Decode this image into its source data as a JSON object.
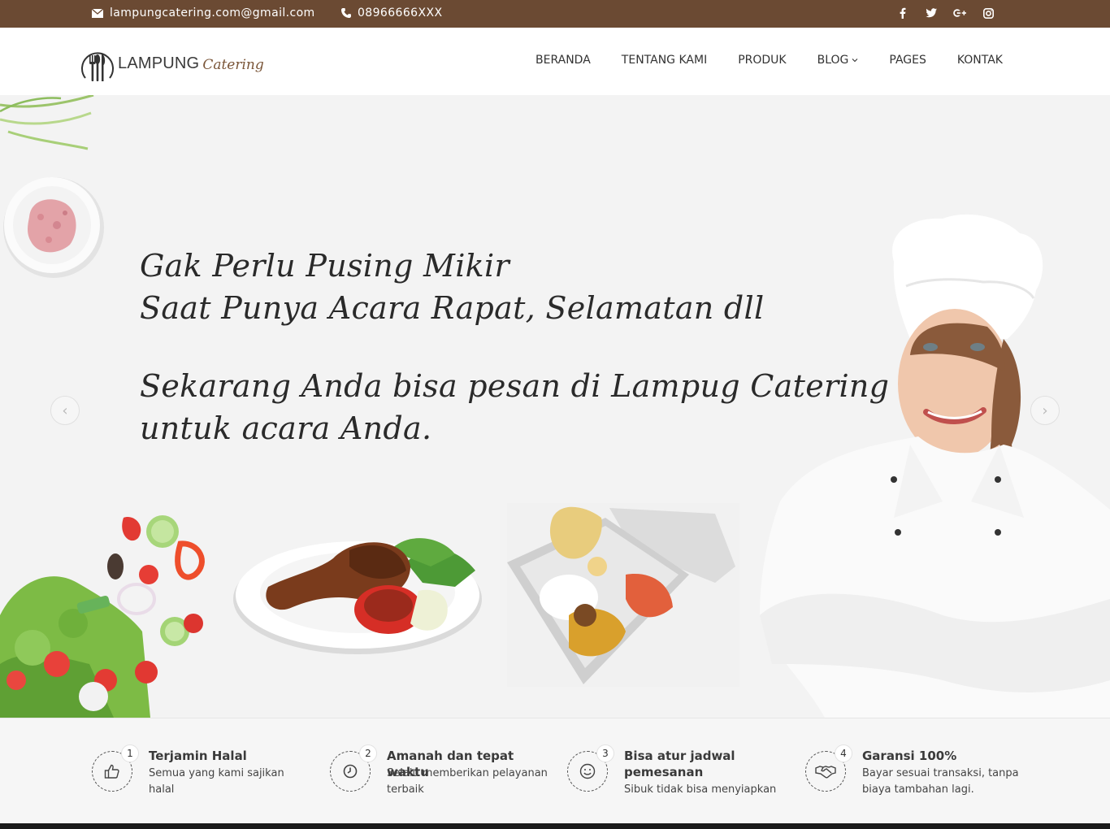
{
  "topbar": {
    "email": "lampungcatering.com@gmail.com",
    "phone": "08966666XXX",
    "social_icons": [
      "facebook-icon",
      "twitter-icon",
      "google-plus-icon",
      "instagram-icon"
    ],
    "bg_color": "#6b4a33"
  },
  "logo": {
    "main": "LAMPUNG",
    "script": "Catering"
  },
  "nav": {
    "items": [
      {
        "label": "BERANDA"
      },
      {
        "label": "TENTANG KAMI"
      },
      {
        "label": "PRODUK"
      },
      {
        "label": "BLOG"
      },
      {
        "label": "PAGES"
      },
      {
        "label": "KONTAK"
      }
    ]
  },
  "hero": {
    "line1": "Gak Perlu Pusing Mikir",
    "line2": "Saat Punya Acara Rapat, Selamatan dll",
    "line3": "Sekarang Anda bisa pesan di Lampug Catering",
    "line4": "untuk acara Anda.",
    "prev_arrow": "‹",
    "next_arrow": "›"
  },
  "features": [
    {
      "num": "1",
      "title": "Terjamin Halal",
      "desc": "Semua yang kami sajikan halal",
      "icon": "thumbs-up-icon"
    },
    {
      "num": "2",
      "title": "Amanah dan tepat waktu",
      "desc": "Selalu memberikan pelayanan terbaik",
      "icon": "clock-icon"
    },
    {
      "num": "3",
      "title": "Bisa atur jadwal pemesanan",
      "desc": "Sibuk tidak bisa menyiapkan",
      "icon": "smile-icon"
    },
    {
      "num": "4",
      "title": "Garansi 100%",
      "desc": "Bayar sesuai transaksi, tanpa biaya tambahan lagi.",
      "icon": "handshake-icon"
    }
  ]
}
